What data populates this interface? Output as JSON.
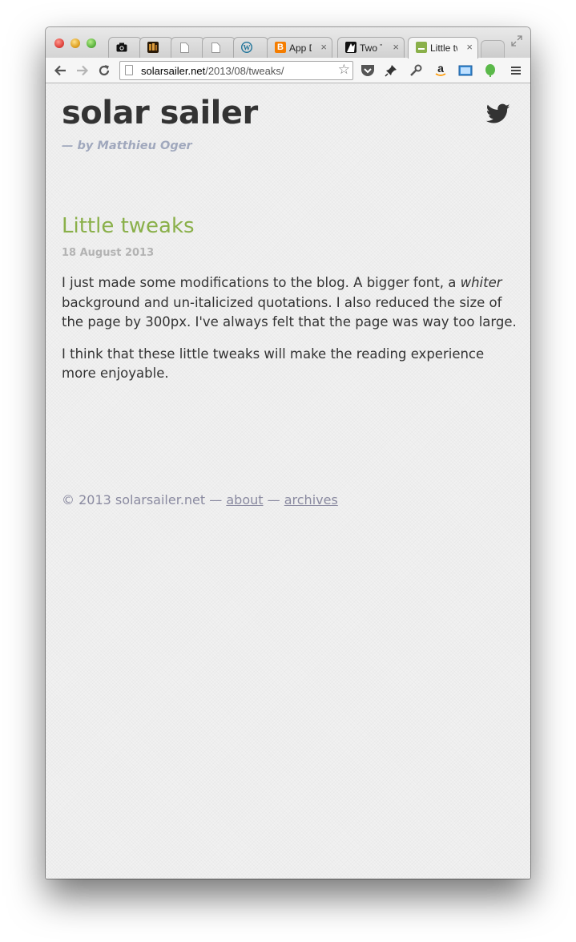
{
  "browser": {
    "tabs": [
      {
        "label": "",
        "favicon": "camera-icon",
        "favicon_glyph": "📷",
        "favicon_color": "#000000",
        "active": false
      },
      {
        "label": "",
        "favicon": "game-icon",
        "favicon_glyph": "▦",
        "favicon_color": "#7a4a10",
        "active": false
      },
      {
        "label": "",
        "favicon": "blank-page-icon",
        "favicon_glyph": "🗋",
        "favicon_color": "#888888",
        "active": false
      },
      {
        "label": "",
        "favicon": "blank-page-icon",
        "favicon_glyph": "🗋",
        "favicon_color": "#888888",
        "active": false
      },
      {
        "label": "",
        "favicon": "wordpress-icon",
        "favicon_glyph": "W",
        "favicon_color": "#21759b",
        "active": false
      },
      {
        "label": "App De",
        "favicon": "blogger-icon",
        "favicon_glyph": "B",
        "favicon_color": "#f57d00",
        "active": false
      },
      {
        "label": "Two Ta",
        "favicon": "twotabs-icon",
        "favicon_glyph": "◣",
        "favicon_color": "#111111",
        "active": false
      },
      {
        "label": "Little tw",
        "favicon": "solarsailer-icon",
        "favicon_glyph": "▬",
        "favicon_color": "#8ab04a",
        "active": true
      }
    ],
    "close_glyph": "×",
    "url_domain": "solarsailer.net",
    "url_path": "/2013/08/tweaks/"
  },
  "page": {
    "site_title": "solar sailer",
    "byline": "— by Matthieu Oger",
    "post_title": "Little tweaks",
    "post_date": "18 August 2013",
    "para1_before": "I just made some modifications to the blog. A bigger font, a ",
    "para1_em": "whiter",
    "para1_after": " background and un-italicized quotations. I also reduced the size of the page by 300px. I've always felt that the page was way too large.",
    "para2": "I think that these little tweaks will make the reading experience more enjoyable.",
    "footer_copyright": "© 2013 solarsailer.net —",
    "footer_about": "about",
    "footer_sep": "—",
    "footer_archives": "archives"
  },
  "colors": {
    "title": "#333333",
    "byline": "#a0a8bd",
    "post_title": "#8ab04a",
    "date": "#b3b3b3",
    "footer": "#8a8aa0"
  }
}
